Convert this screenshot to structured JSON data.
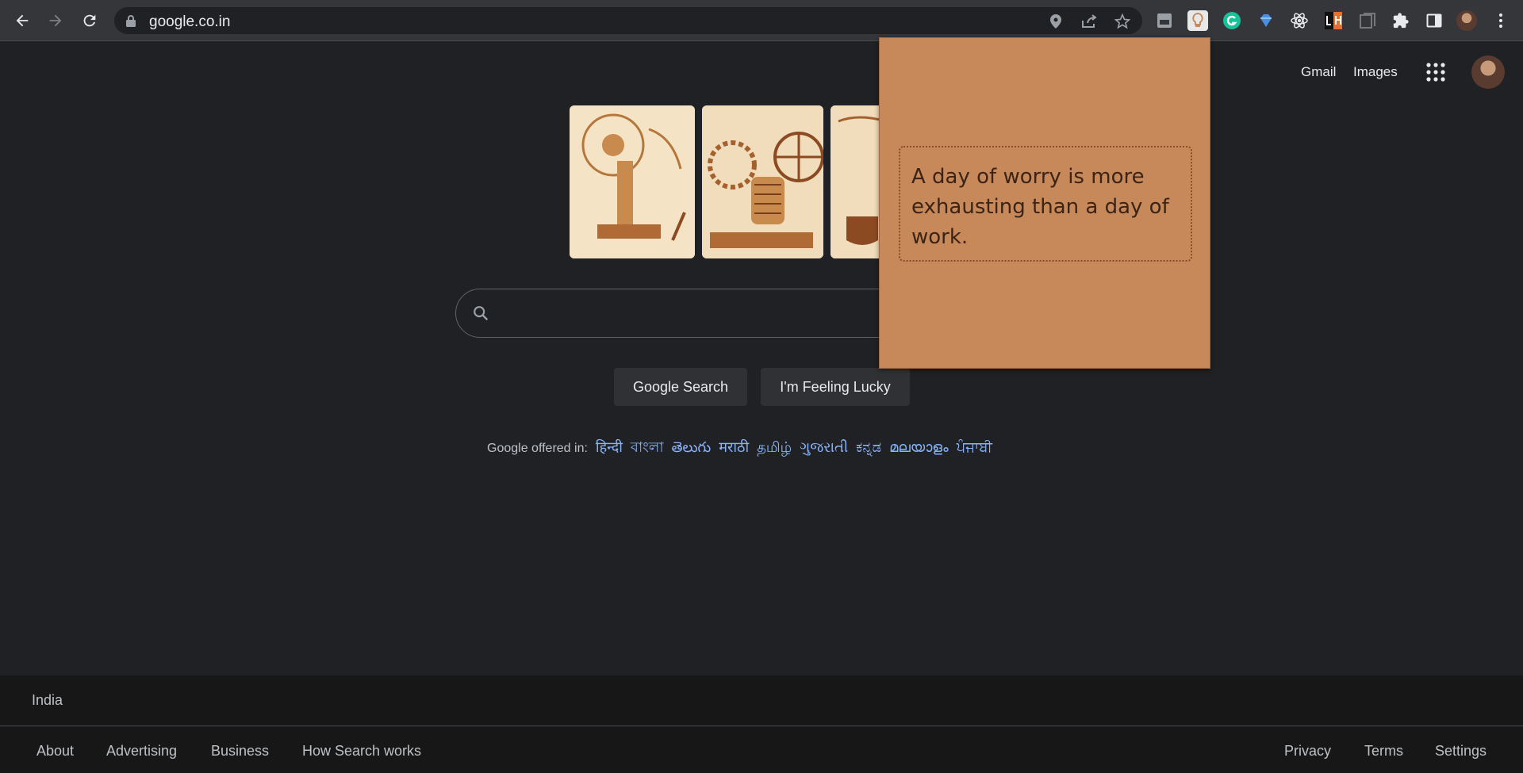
{
  "browser": {
    "url": "google.co.in",
    "icons": [
      "back-icon",
      "forward-icon",
      "reload-icon",
      "lock-icon",
      "location-icon",
      "share-icon",
      "bookmark-star-icon",
      "extensions-icon",
      "side-panel-icon",
      "menu-icon"
    ]
  },
  "header": {
    "gmail": "Gmail",
    "images": "Images"
  },
  "search": {
    "google_search": "Google Search",
    "feeling_lucky": "I'm Feeling Lucky"
  },
  "languages": {
    "label": "Google offered in:",
    "items": [
      "हिन्दी",
      "বাংলা",
      "తెలుగు",
      "मराठी",
      "தமிழ்",
      "ગુજરાતી",
      "ಕನ್ನಡ",
      "മലയാളം",
      "ਪੰਜਾਬੀ"
    ]
  },
  "popup": {
    "quote": "A day of worry is more exhausting than a day of work."
  },
  "footer": {
    "country": "India",
    "left_links": [
      "About",
      "Advertising",
      "Business",
      "How Search works"
    ],
    "right_links": [
      "Privacy",
      "Terms",
      "Settings"
    ]
  },
  "colors": {
    "page_bg": "#202124",
    "popup_bg": "#c8895a",
    "link": "#8ab4f8"
  }
}
